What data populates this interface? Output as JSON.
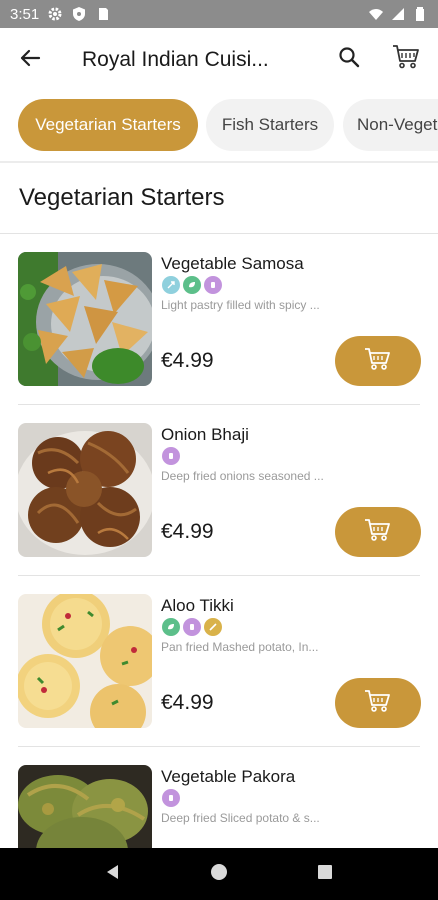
{
  "status_bar": {
    "time": "3:51",
    "left_icons": [
      "settings-icon",
      "shield-icon",
      "sd-card-icon"
    ],
    "right_icons": [
      "wifi-icon",
      "signal-icon",
      "battery-icon"
    ]
  },
  "app_bar": {
    "title": "Royal Indian Cuisi...",
    "back_icon": "arrow-back-icon",
    "search_icon": "search-icon",
    "cart_icon": "cart-icon"
  },
  "tabs": [
    {
      "label": "Vegetarian Starters",
      "active": true
    },
    {
      "label": "Fish Starters",
      "active": false
    },
    {
      "label": "Non-Veget",
      "active": false
    }
  ],
  "section": {
    "title": "Vegetarian Starters"
  },
  "items": [
    {
      "name": "Vegetable Samosa",
      "description": "Light pastry filled with spicy ...",
      "price": "€4.99",
      "tags": [
        "lightblue-tag",
        "green-tag",
        "purple-tag"
      ]
    },
    {
      "name": "Onion Bhaji",
      "description": "Deep fried onions seasoned ...",
      "price": "€4.99",
      "tags": [
        "purple-tag"
      ]
    },
    {
      "name": "Aloo Tikki",
      "description": "Pan fried Mashed potato, In...",
      "price": "€4.99",
      "tags": [
        "green-tag",
        "purple-tag",
        "gold-tag"
      ]
    },
    {
      "name": "Vegetable Pakora",
      "description": "Deep fried Sliced potato & s...",
      "price": "",
      "tags": [
        "purple-tag"
      ]
    }
  ],
  "colors": {
    "accent": "#c9973a",
    "tag_lightblue": "#8fd0dd",
    "tag_green": "#5cbf8a",
    "tag_purple": "#c293dd",
    "tag_gold": "#d9b24a"
  },
  "nav_bar": {
    "back": "nav-back-icon",
    "home": "nav-home-icon",
    "recents": "nav-recents-icon"
  }
}
